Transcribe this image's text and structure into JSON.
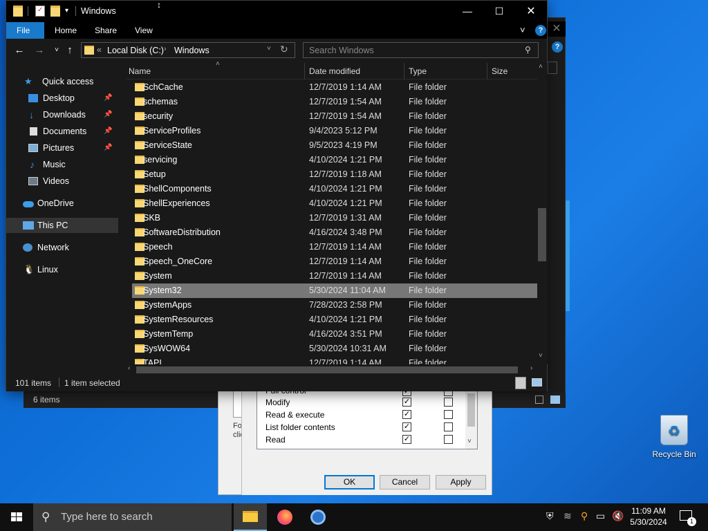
{
  "desktop": {
    "recycle_bin": "Recycle Bin"
  },
  "back_window": {
    "status": "6 items"
  },
  "permissions_dialog": {
    "rows": [
      {
        "label": "Full control",
        "allow": true,
        "deny": false
      },
      {
        "label": "Modify",
        "allow": true,
        "deny": false
      },
      {
        "label": "Read & execute",
        "allow": true,
        "deny": false
      },
      {
        "label": "List folder contents",
        "allow": true,
        "deny": false
      },
      {
        "label": "Read",
        "allow": true,
        "deny": false
      }
    ],
    "side_text": "For clic",
    "ok": "OK",
    "cancel": "Cancel",
    "apply": "Apply"
  },
  "explorer": {
    "title": "Windows",
    "ribbon_tabs": [
      "File",
      "Home",
      "Share",
      "View"
    ],
    "breadcrumb": [
      "Local Disk (C:)",
      "Windows"
    ],
    "search_placeholder": "Search Windows",
    "columns": [
      "Name",
      "Date modified",
      "Type",
      "Size"
    ],
    "nav": [
      {
        "label": "Quick access",
        "icon": "star-icon",
        "pinned": false
      },
      {
        "label": "Desktop",
        "icon": "desktop-icon",
        "pinned": true
      },
      {
        "label": "Downloads",
        "icon": "download-icon",
        "pinned": true
      },
      {
        "label": "Documents",
        "icon": "documents-icon",
        "pinned": true
      },
      {
        "label": "Pictures",
        "icon": "pictures-icon",
        "pinned": true
      },
      {
        "label": "Music",
        "icon": "music-icon",
        "pinned": false
      },
      {
        "label": "Videos",
        "icon": "videos-icon",
        "pinned": false
      },
      {
        "label": "OneDrive",
        "icon": "cloud-icon",
        "pinned": false
      },
      {
        "label": "This PC",
        "icon": "computer-icon",
        "pinned": false
      },
      {
        "label": "Network",
        "icon": "network-icon",
        "pinned": false
      },
      {
        "label": "Linux",
        "icon": "linux-icon",
        "pinned": false
      }
    ],
    "files": [
      {
        "name": "SchCache",
        "date": "12/7/2019 1:14 AM",
        "type": "File folder"
      },
      {
        "name": "schemas",
        "date": "12/7/2019 1:54 AM",
        "type": "File folder"
      },
      {
        "name": "security",
        "date": "12/7/2019 1:54 AM",
        "type": "File folder"
      },
      {
        "name": "ServiceProfiles",
        "date": "9/4/2023 5:12 PM",
        "type": "File folder"
      },
      {
        "name": "ServiceState",
        "date": "9/5/2023 4:19 PM",
        "type": "File folder"
      },
      {
        "name": "servicing",
        "date": "4/10/2024 1:21 PM",
        "type": "File folder"
      },
      {
        "name": "Setup",
        "date": "12/7/2019 1:18 AM",
        "type": "File folder"
      },
      {
        "name": "ShellComponents",
        "date": "4/10/2024 1:21 PM",
        "type": "File folder"
      },
      {
        "name": "ShellExperiences",
        "date": "4/10/2024 1:21 PM",
        "type": "File folder"
      },
      {
        "name": "SKB",
        "date": "12/7/2019 1:31 AM",
        "type": "File folder"
      },
      {
        "name": "SoftwareDistribution",
        "date": "4/16/2024 3:48 PM",
        "type": "File folder"
      },
      {
        "name": "Speech",
        "date": "12/7/2019 1:14 AM",
        "type": "File folder"
      },
      {
        "name": "Speech_OneCore",
        "date": "12/7/2019 1:14 AM",
        "type": "File folder"
      },
      {
        "name": "System",
        "date": "12/7/2019 1:14 AM",
        "type": "File folder"
      },
      {
        "name": "System32",
        "date": "5/30/2024 11:04 AM",
        "type": "File folder",
        "selected": true
      },
      {
        "name": "SystemApps",
        "date": "7/28/2023 2:58 PM",
        "type": "File folder"
      },
      {
        "name": "SystemResources",
        "date": "4/10/2024 1:21 PM",
        "type": "File folder"
      },
      {
        "name": "SystemTemp",
        "date": "4/16/2024 3:51 PM",
        "type": "File folder"
      },
      {
        "name": "SysWOW64",
        "date": "5/30/2024 10:31 AM",
        "type": "File folder"
      },
      {
        "name": "TAPI",
        "date": "12/7/2019 1:14 AM",
        "type": "File folder"
      }
    ],
    "status_items": "101 items",
    "status_selected": "1 item selected"
  },
  "taskbar": {
    "search_placeholder": "Type here to search",
    "time": "11:09 AM",
    "date": "5/30/2024",
    "notification_count": "1"
  },
  "colors": {
    "accent": "#1979ca",
    "folder": "#f8d775",
    "selection": "#777777"
  }
}
